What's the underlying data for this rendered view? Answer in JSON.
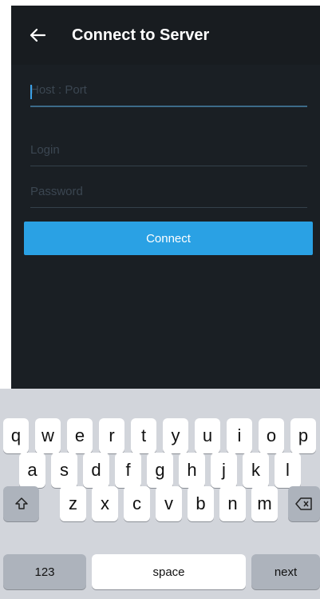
{
  "header": {
    "title": "Connect to Server",
    "back_icon": "arrow-left-icon"
  },
  "form": {
    "host_port": {
      "value": "",
      "placeholder": "Host : Port"
    },
    "login": {
      "value": "",
      "placeholder": "Login"
    },
    "password": {
      "value": "",
      "placeholder": "Password"
    },
    "connect_label": "Connect"
  },
  "keyboard": {
    "row1": [
      "q",
      "w",
      "e",
      "r",
      "t",
      "y",
      "u",
      "i",
      "o",
      "p"
    ],
    "row2": [
      "a",
      "s",
      "d",
      "f",
      "g",
      "h",
      "j",
      "k",
      "l"
    ],
    "row3": [
      "z",
      "x",
      "c",
      "v",
      "b",
      "n",
      "m"
    ],
    "shift_icon": "shift-icon",
    "backspace_icon": "backspace-icon",
    "numbers_label": "123",
    "space_label": "space",
    "next_label": "next"
  },
  "colors": {
    "background": "#1a1f24",
    "app_bar": "#181c20",
    "accent": "#2aa1e4",
    "keyboard_bg": "#d2d5db",
    "key_bg": "#ffffff",
    "key_dark_bg": "#adb3bc"
  }
}
